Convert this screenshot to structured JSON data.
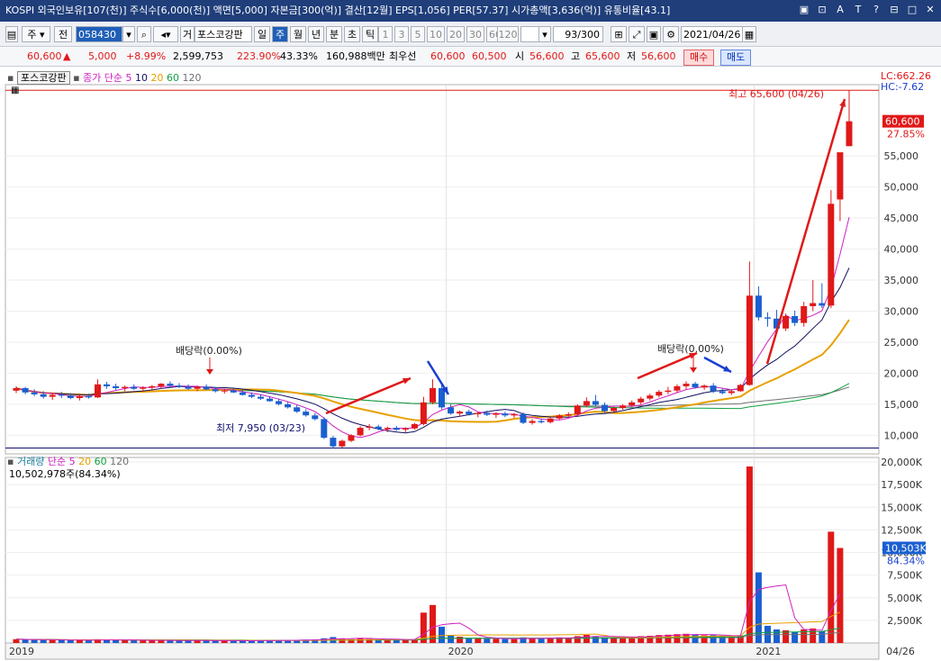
{
  "title_bar": {
    "text": "KOSPI 외국인보유[107(천)] 주식수[6,000(천)] 액면[5,000] 자본금[300(억)] 결산[12월] EPS[1,056] PER[57.37] 시가총액[3,636(억)] 유통비율[43.1]",
    "icons": [
      "▣",
      "⊡",
      "A",
      "T",
      "?",
      "⊟",
      "□",
      "✕"
    ]
  },
  "toolbar": {
    "type_select": "주",
    "scope_select": "전",
    "stock_code": "058430",
    "stock_name_prefix": "거",
    "stock_name": "포스코강판",
    "periods": [
      "일",
      "주",
      "월",
      "년",
      "분",
      "초",
      "틱"
    ],
    "selected_period": "주",
    "intervals": [
      "1",
      "3",
      "5",
      "10",
      "20",
      "30",
      "60",
      "120"
    ],
    "count": "93/300",
    "date": "2021/04/26"
  },
  "quote": {
    "price": "60,600",
    "arrow": "▲",
    "change": "5,000",
    "change_pct": "+8.99%",
    "volume": "2,599,753",
    "vol_ratio": "223.90%",
    "turnover": "43.33%",
    "amount": "160,988백만",
    "ask_label": "최우선",
    "ask": "60,600",
    "bid": "60,500",
    "open_label": "시",
    "open": "56,600",
    "high_label": "고",
    "high": "65,600",
    "low_label": "저",
    "low": "56,600",
    "buy_label": "매수",
    "sell_label": "매도"
  },
  "price_panel": {
    "stock_tag": "포스코강판",
    "legend_prefix": "종가 단순",
    "ma_labels": [
      "5",
      "10",
      "20",
      "60",
      "120"
    ],
    "ma_colors": [
      "#d020c0",
      "#101060",
      "#e8a000",
      "#10a040",
      "#707070"
    ],
    "lc": "LC:662.26",
    "hc": "HC:-7.62",
    "high_annotation": "최고 65,600 (04/26)",
    "low_annotation": "최저 7,950 (03/23)",
    "dividend_label": "배당락(0.00%)",
    "current_price": "60,600",
    "current_pct": "27.85%"
  },
  "volume_panel": {
    "legend_prefix": "거래량",
    "legend_simple": "단순",
    "ma_labels": [
      "5",
      "20",
      "60",
      "120"
    ],
    "ma_colors": [
      "#d020c0",
      "#e8a000",
      "#10a040",
      "#707070"
    ],
    "current_volume": "10,502,978주(84.34%)",
    "current_tag": "10,503K",
    "current_pct": "84.34%"
  },
  "x_labels": [
    "2019",
    "2020",
    "2021",
    "04/26"
  ],
  "colors": {
    "up": "#e01818",
    "down": "#1a5fd0",
    "title_bg": "#1f3e7a"
  },
  "chart_data": {
    "type": "candlestick",
    "price_axis": {
      "ticks": [
        10000,
        15000,
        20000,
        25000,
        30000,
        35000,
        40000,
        45000,
        50000,
        55000
      ],
      "ylim": [
        7000,
        66500
      ]
    },
    "volume_axis": {
      "ticks": [
        2500,
        5000,
        7500,
        10000,
        12500,
        15000,
        17500,
        20000
      ],
      "unit": "K",
      "ylim": [
        0,
        20500
      ]
    },
    "candles": [
      [
        17200,
        17900,
        16800,
        17600
      ],
      [
        17600,
        17800,
        16600,
        16900
      ],
      [
        16900,
        17400,
        16300,
        16600
      ],
      [
        16600,
        17100,
        15900,
        16200
      ],
      [
        16200,
        16800,
        15700,
        16500
      ],
      [
        16500,
        17000,
        16000,
        16400
      ],
      [
        16400,
        16800,
        15800,
        16000
      ],
      [
        16000,
        16500,
        15600,
        16300
      ],
      [
        16300,
        16700,
        15900,
        16100
      ],
      [
        16100,
        19000,
        16000,
        18200
      ],
      [
        18200,
        18600,
        17500,
        17900
      ],
      [
        17900,
        18300,
        17300,
        17600
      ],
      [
        17600,
        18000,
        17100,
        17800
      ],
      [
        17800,
        18200,
        17300,
        17500
      ],
      [
        17500,
        17900,
        17000,
        17700
      ],
      [
        17700,
        18100,
        17200,
        17900
      ],
      [
        17900,
        18400,
        17500,
        18300
      ],
      [
        18300,
        18700,
        17800,
        18000
      ],
      [
        18000,
        18400,
        17600,
        17800
      ],
      [
        17800,
        18200,
        17300,
        17500
      ],
      [
        17500,
        18000,
        17100,
        17800
      ],
      [
        17800,
        18200,
        17300,
        17400
      ],
      [
        17400,
        17800,
        16900,
        17100
      ],
      [
        17100,
        17500,
        16700,
        17200
      ],
      [
        17200,
        17600,
        16800,
        16900
      ],
      [
        16900,
        17300,
        16400,
        16500
      ],
      [
        16500,
        16900,
        16000,
        16200
      ],
      [
        16200,
        16600,
        15700,
        15900
      ],
      [
        15900,
        16300,
        15400,
        15500
      ],
      [
        15500,
        15900,
        14800,
        15000
      ],
      [
        15000,
        15400,
        14300,
        14500
      ],
      [
        14500,
        14900,
        13600,
        13800
      ],
      [
        13800,
        14200,
        13000,
        13200
      ],
      [
        13200,
        13600,
        12400,
        12600
      ],
      [
        12600,
        12900,
        9400,
        9600
      ],
      [
        9600,
        9900,
        7950,
        8200
      ],
      [
        8200,
        9300,
        8000,
        9100
      ],
      [
        9100,
        10200,
        8900,
        10000
      ],
      [
        10000,
        11500,
        9800,
        11200
      ],
      [
        11200,
        11800,
        10800,
        11400
      ],
      [
        11400,
        11700,
        10800,
        11000
      ],
      [
        11000,
        11400,
        10500,
        11200
      ],
      [
        11200,
        11500,
        10700,
        10900
      ],
      [
        10900,
        11300,
        10500,
        11100
      ],
      [
        11100,
        12000,
        10900,
        11800
      ],
      [
        11800,
        16200,
        11600,
        15300
      ],
      [
        15300,
        19000,
        15000,
        17600
      ],
      [
        17600,
        18500,
        14200,
        14500
      ],
      [
        14500,
        15000,
        13300,
        13500
      ],
      [
        13500,
        14000,
        13000,
        13800
      ],
      [
        13800,
        14100,
        13200,
        13400
      ],
      [
        13400,
        13800,
        12900,
        13600
      ],
      [
        13600,
        14000,
        13100,
        13300
      ],
      [
        13300,
        13700,
        12800,
        13500
      ],
      [
        13500,
        13800,
        12900,
        13200
      ],
      [
        13200,
        13600,
        12800,
        13400
      ],
      [
        13400,
        13700,
        11800,
        12000
      ],
      [
        12000,
        12600,
        11700,
        12300
      ],
      [
        12300,
        12700,
        11900,
        12100
      ],
      [
        12100,
        12900,
        11900,
        12700
      ],
      [
        12700,
        13400,
        12500,
        13200
      ],
      [
        13200,
        13700,
        12900,
        13400
      ],
      [
        13400,
        15000,
        13200,
        14800
      ],
      [
        14800,
        16100,
        14500,
        15500
      ],
      [
        15500,
        16500,
        14700,
        14900
      ],
      [
        14900,
        15300,
        13600,
        13900
      ],
      [
        13900,
        14600,
        13700,
        14400
      ],
      [
        14400,
        15000,
        14100,
        14800
      ],
      [
        14800,
        15600,
        14600,
        15300
      ],
      [
        15300,
        16200,
        15000,
        15900
      ],
      [
        15900,
        16700,
        15600,
        16400
      ],
      [
        16400,
        17300,
        16100,
        17000
      ],
      [
        17000,
        17800,
        16600,
        17200
      ],
      [
        17200,
        18200,
        16900,
        17900
      ],
      [
        17900,
        18700,
        17400,
        18300
      ],
      [
        18300,
        18600,
        17500,
        17700
      ],
      [
        17700,
        18200,
        17300,
        18000
      ],
      [
        18000,
        18400,
        16800,
        17100
      ],
      [
        17100,
        17600,
        16600,
        16800
      ],
      [
        16800,
        17300,
        16500,
        17100
      ],
      [
        17100,
        18300,
        17000,
        18100
      ],
      [
        18100,
        38000,
        18000,
        32500
      ],
      [
        32500,
        34000,
        28500,
        29000
      ],
      [
        29000,
        29800,
        27500,
        28800
      ],
      [
        28800,
        30200,
        26500,
        27200
      ],
      [
        27200,
        29600,
        26800,
        29200
      ],
      [
        29200,
        30100,
        27600,
        28100
      ],
      [
        28100,
        31500,
        27500,
        30800
      ],
      [
        30800,
        35000,
        30000,
        31300
      ],
      [
        31300,
        34500,
        30500,
        30900
      ],
      [
        30900,
        49500,
        30500,
        47300
      ],
      [
        48000,
        52000,
        44500,
        55600
      ],
      [
        56600,
        65600,
        56600,
        60600
      ]
    ],
    "volumes": [
      420,
      380,
      360,
      340,
      330,
      320,
      310,
      300,
      290,
      420,
      350,
      320,
      300,
      290,
      280,
      270,
      300,
      280,
      270,
      260,
      270,
      260,
      250,
      250,
      240,
      250,
      260,
      270,
      280,
      300,
      320,
      340,
      360,
      380,
      520,
      660,
      480,
      420,
      560,
      440,
      410,
      380,
      360,
      350,
      400,
      3350,
      4200,
      1800,
      900,
      700,
      560,
      520,
      480,
      460,
      440,
      430,
      620,
      520,
      480,
      560,
      620,
      600,
      760,
      900,
      700,
      620,
      600,
      640,
      700,
      760,
      800,
      880,
      920,
      980,
      1020,
      900,
      860,
      880,
      760,
      700,
      820,
      19500,
      7800,
      1900,
      1500,
      1400,
      1200,
      1500,
      1600,
      1300,
      12300,
      10503
    ]
  }
}
